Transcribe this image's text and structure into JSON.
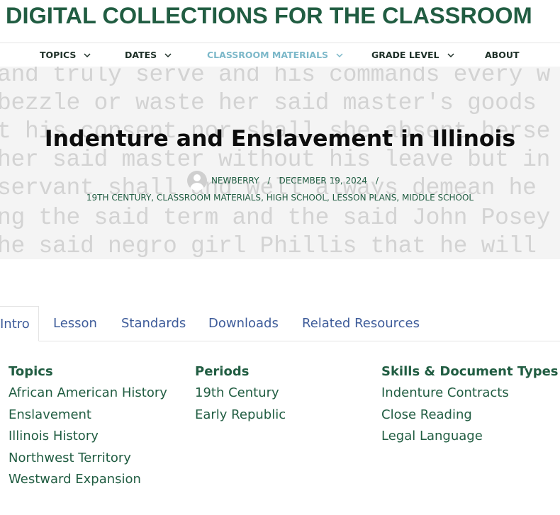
{
  "site": {
    "title": "DIGITAL COLLECTIONS FOR THE CLASSROOM"
  },
  "nav": {
    "topics": "TOPICS",
    "dates": "DATES",
    "classroom_materials": "CLASSROOM MATERIALS",
    "grade_level": "GRADE LEVEL",
    "about": "ABOUT"
  },
  "colors": {
    "brand_green": "#215d42",
    "active_nav": "#7cb8c9",
    "tab_link": "#3e5c9a"
  },
  "hero": {
    "background_text": [
      "and truly serve and his commands every w",
      "bezzle or waste her said master's goods",
      "t his consent nor shall she absent herse",
      "her said master without his leave but in",
      " servant shall and well always demean he",
      "ng the said term and the said John Posey",
      "he said negro girl Phillis that he will"
    ],
    "title": "Indenture and Enslavement in Illinois",
    "author": "NEWBERRY",
    "date": "DECEMBER 19, 2024",
    "categories": [
      "19TH CENTURY",
      "CLASSROOM MATERIALS",
      "HIGH SCHOOL",
      "LESSON PLANS",
      "MIDDLE SCHOOL"
    ]
  },
  "tabs": {
    "intro": "Intro",
    "lesson": "Lesson",
    "standards": "Standards",
    "downloads": "Downloads",
    "related_resources": "Related Resources"
  },
  "columns": {
    "topics": {
      "heading": "Topics",
      "items": [
        "African American History",
        "Enslavement",
        "Illinois History",
        "Northwest Territory",
        "Westward Expansion"
      ]
    },
    "periods": {
      "heading": "Periods",
      "items": [
        "19th Century",
        "Early Republic"
      ]
    },
    "skills": {
      "heading": "Skills & Document Types",
      "items": [
        "Indenture Contracts",
        "Close Reading",
        "Legal Language"
      ]
    }
  }
}
